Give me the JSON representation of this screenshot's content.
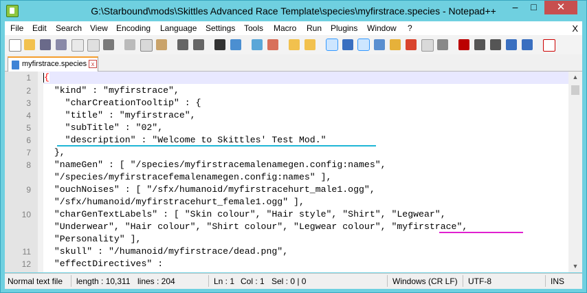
{
  "window": {
    "title": "G:\\Starbound\\mods\\Skittles Advanced Race Template\\species\\myfirstrace.species - Notepad++",
    "minimize": "–",
    "maximize": "□",
    "close": "✕"
  },
  "menu": {
    "items": [
      "File",
      "Edit",
      "Search",
      "View",
      "Encoding",
      "Language",
      "Settings",
      "Tools",
      "Macro",
      "Run",
      "Plugins",
      "Window",
      "?"
    ],
    "close": "X"
  },
  "toolbar": {
    "icons": [
      "new-file-icon",
      "open-file-icon",
      "save-icon",
      "save-all-icon",
      "close-icon",
      "close-all-icon",
      "print-icon",
      "cut-icon",
      "copy-icon",
      "paste-icon",
      "undo-icon",
      "redo-icon",
      "find-icon",
      "replace-icon",
      "zoom-in-icon",
      "zoom-out-icon",
      "sync-v-icon",
      "sync-h-icon",
      "word-wrap-icon",
      "show-all-chars-icon",
      "indent-guide-icon",
      "doc-map-icon",
      "function-list-icon",
      "folder-workspace-icon",
      "monitor-icon",
      "record-macro-icon",
      "stop-record-icon",
      "play-macro-icon",
      "run-macro-multiple-icon",
      "save-macro-icon",
      "spellcheck-icon"
    ]
  },
  "tab": {
    "label": "myfirstrace.species",
    "close": "x"
  },
  "code": {
    "lines": [
      {
        "n": "1",
        "text": "{"
      },
      {
        "n": "2",
        "text": "  \"kind\" : \"myfirstrace\","
      },
      {
        "n": "3",
        "text": "    \"charCreationTooltip\" : {"
      },
      {
        "n": "4",
        "text": "    \"title\" : \"myfirstrace\","
      },
      {
        "n": "5",
        "text": "    \"subTitle\" : \"02\","
      },
      {
        "n": "6",
        "text": "    \"description\" : \"Welcome to Skittles' Test Mod.\""
      },
      {
        "n": "7",
        "text": "  },"
      },
      {
        "n": "8",
        "text": "  \"nameGen\" : [ \"/species/myfirstracemalenamegen.config:names\","
      },
      {
        "n": "",
        "text": "  \"/species/myfirstracefemalenamegen.config:names\" ],"
      },
      {
        "n": "9",
        "text": "  \"ouchNoises\" : [ \"/sfx/humanoid/myfirstracehurt_male1.ogg\","
      },
      {
        "n": "",
        "text": "  \"/sfx/humanoid/myfirstracehurt_female1.ogg\" ],"
      },
      {
        "n": "10",
        "text": "  \"charGenTextLabels\" : [ \"Skin colour\", \"Hair style\", \"Shirt\", \"Legwear\","
      },
      {
        "n": "",
        "text": "  \"Underwear\", \"Hair colour\", \"Shirt colour\", \"Legwear colour\", \"myfirstrace\","
      },
      {
        "n": "",
        "text": "  \"Personality\" ],"
      },
      {
        "n": "11",
        "text": "  \"skull\" : \"/humanoid/myfirstrace/dead.png\","
      },
      {
        "n": "12",
        "text": "  \"effectDirectives\" :"
      }
    ]
  },
  "status": {
    "file_type": "Normal text file",
    "length": "length : 10,311",
    "lines": "lines : 204",
    "ln": "Ln : 1",
    "col": "Col : 1",
    "sel": "Sel : 0 | 0",
    "eol": "Windows (CR LF)",
    "encoding": "UTF-8",
    "mode": "INS"
  },
  "colors": {
    "title_bar": "#6fd0e0",
    "close_button": "#c74f4f",
    "underline_description": "#1fb6d6",
    "underline_myfirstrace": "#e020d0"
  }
}
